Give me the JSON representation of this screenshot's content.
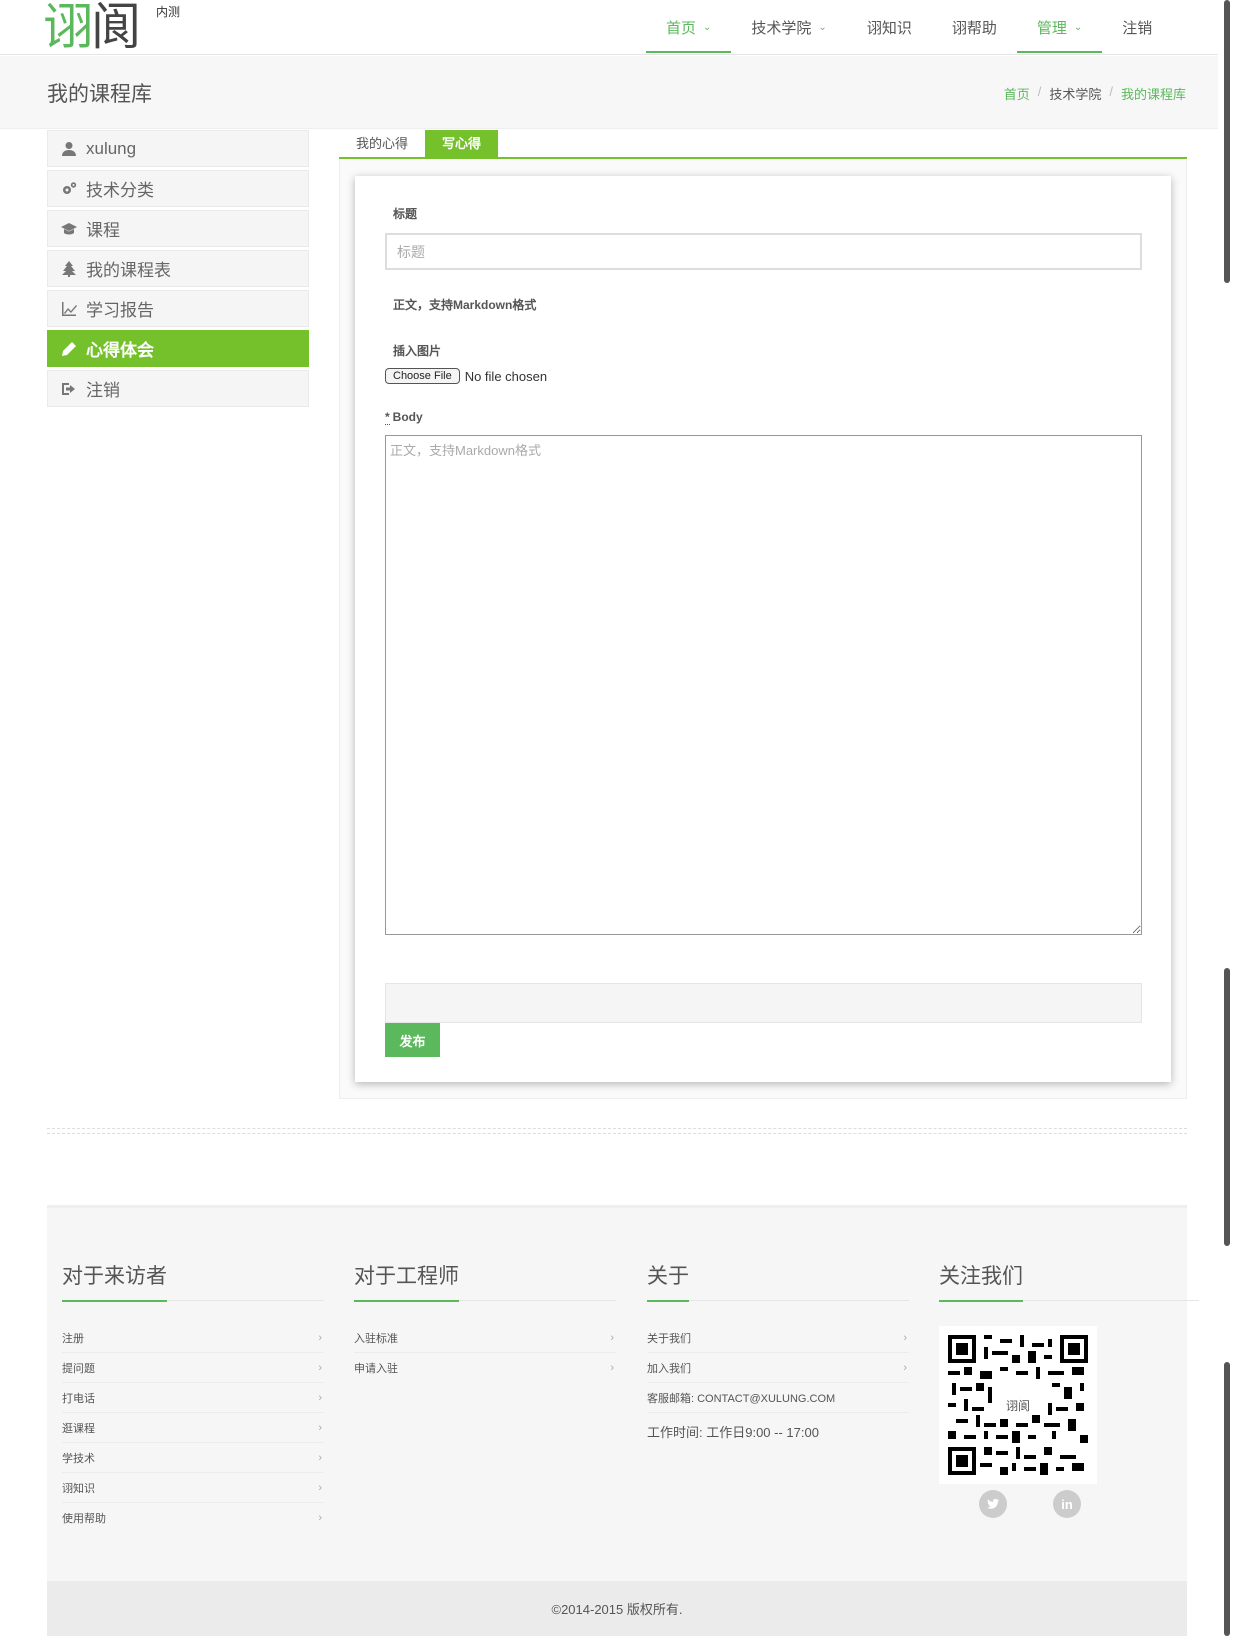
{
  "header": {
    "logo_green": "诩",
    "logo_dark": "阆",
    "beta": "内测",
    "nav": [
      {
        "label": "首页",
        "dropdown": true,
        "active": true
      },
      {
        "label": "技术学院",
        "dropdown": true,
        "active": false
      },
      {
        "label": "诩知识",
        "dropdown": false,
        "active": false
      },
      {
        "label": "诩帮助",
        "dropdown": false,
        "active": false
      },
      {
        "label": "管理",
        "dropdown": true,
        "active": true
      },
      {
        "label": "注销",
        "dropdown": false,
        "active": false
      }
    ]
  },
  "title_bar": {
    "title": "我的课程库",
    "breadcrumb": [
      "首页",
      "技术学院",
      "我的课程库"
    ]
  },
  "sidebar": {
    "items": [
      {
        "label": "xulung",
        "icon": "user-icon"
      },
      {
        "label": "技术分类",
        "icon": "gears-icon"
      },
      {
        "label": "课程",
        "icon": "graduation-cap-icon"
      },
      {
        "label": "我的课程表",
        "icon": "tree-icon"
      },
      {
        "label": "学习报告",
        "icon": "line-chart-icon"
      },
      {
        "label": "心得体会",
        "icon": "pencil-icon",
        "active": true
      },
      {
        "label": "注销",
        "icon": "sign-out-icon"
      }
    ]
  },
  "tabs": [
    {
      "label": "我的心得",
      "active": false
    },
    {
      "label": "写心得",
      "active": true
    }
  ],
  "form": {
    "title_label": "标题",
    "title_placeholder": "标题",
    "body_hint_label": "正文，支持Markdown格式",
    "image_label": "插入图片",
    "file_button": "Choose File",
    "file_status": "No file chosen",
    "body_req": "*",
    "body_label": "Body",
    "body_placeholder": "正文，支持Markdown格式",
    "publish": "发布"
  },
  "footer": {
    "col1": {
      "title": "对于来访者",
      "links": [
        "注册",
        "提问题",
        "打电话",
        "逛课程",
        "学技术",
        "诩知识",
        "使用帮助"
      ]
    },
    "col2": {
      "title": "对于工程师",
      "links": [
        "入驻标准",
        "申请入驻"
      ]
    },
    "col3": {
      "title": "关于",
      "links": [
        "关于我们",
        "加入我们"
      ],
      "email": "客服邮箱: CONTACT@XULUNG.COM",
      "hours": "工作时间:  工作日9:00 -- 17:00"
    },
    "col4": {
      "title": "关注我们",
      "qr_center": "诩阆",
      "social": [
        "twitter-icon",
        "linkedin-icon"
      ]
    }
  },
  "copyright": "©2014-2015 版权所有.",
  "colors": {
    "accent": "#5cb85c",
    "sidebar_active": "#74c12b"
  }
}
